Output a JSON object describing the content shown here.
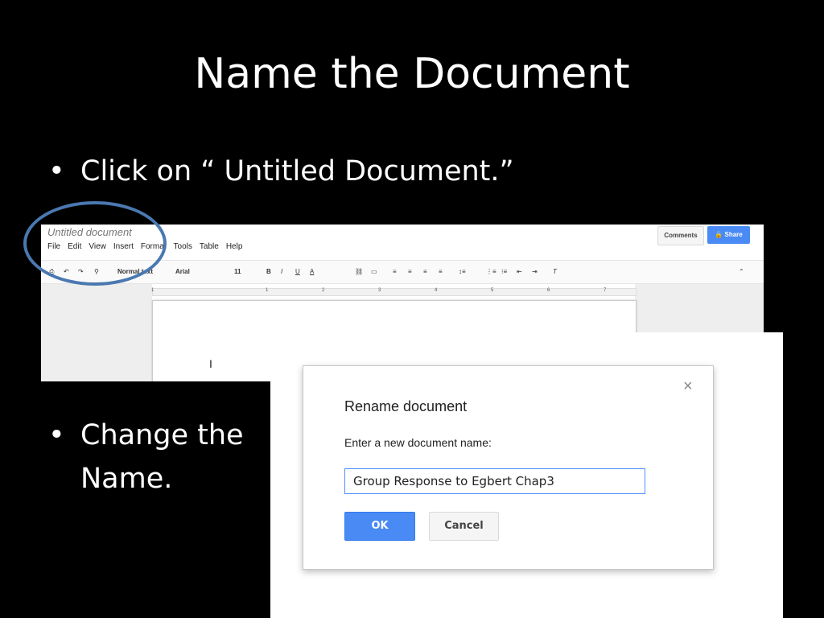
{
  "slide": {
    "title": "Name the Document",
    "bullet1": "Click on “ Untitled Document.”",
    "bullet2": "Change the Name.",
    "bullet_glyph": "•"
  },
  "docs": {
    "doc_title": "Untitled document",
    "menus": [
      "File",
      "Edit",
      "View",
      "Insert",
      "Format",
      "Tools",
      "Table",
      "Help"
    ],
    "comments_label": "Comments",
    "share_label": "Share",
    "toolbar": {
      "style": "Normal text",
      "font": "Arial",
      "size": "11"
    },
    "ruler_numbers": [
      "1",
      "1",
      "2",
      "3",
      "4",
      "5",
      "6",
      "7"
    ],
    "cursor": "I"
  },
  "dialog": {
    "title": "Rename document",
    "prompt": "Enter a new document name:",
    "name_value": "Group Response to Egbert Chap3",
    "ok_label": "OK",
    "cancel_label": "Cancel",
    "close_glyph": "×"
  },
  "colors": {
    "background": "#000000",
    "accent_blue": "#4a8af4",
    "highlight_circle": "#4a78b0"
  }
}
